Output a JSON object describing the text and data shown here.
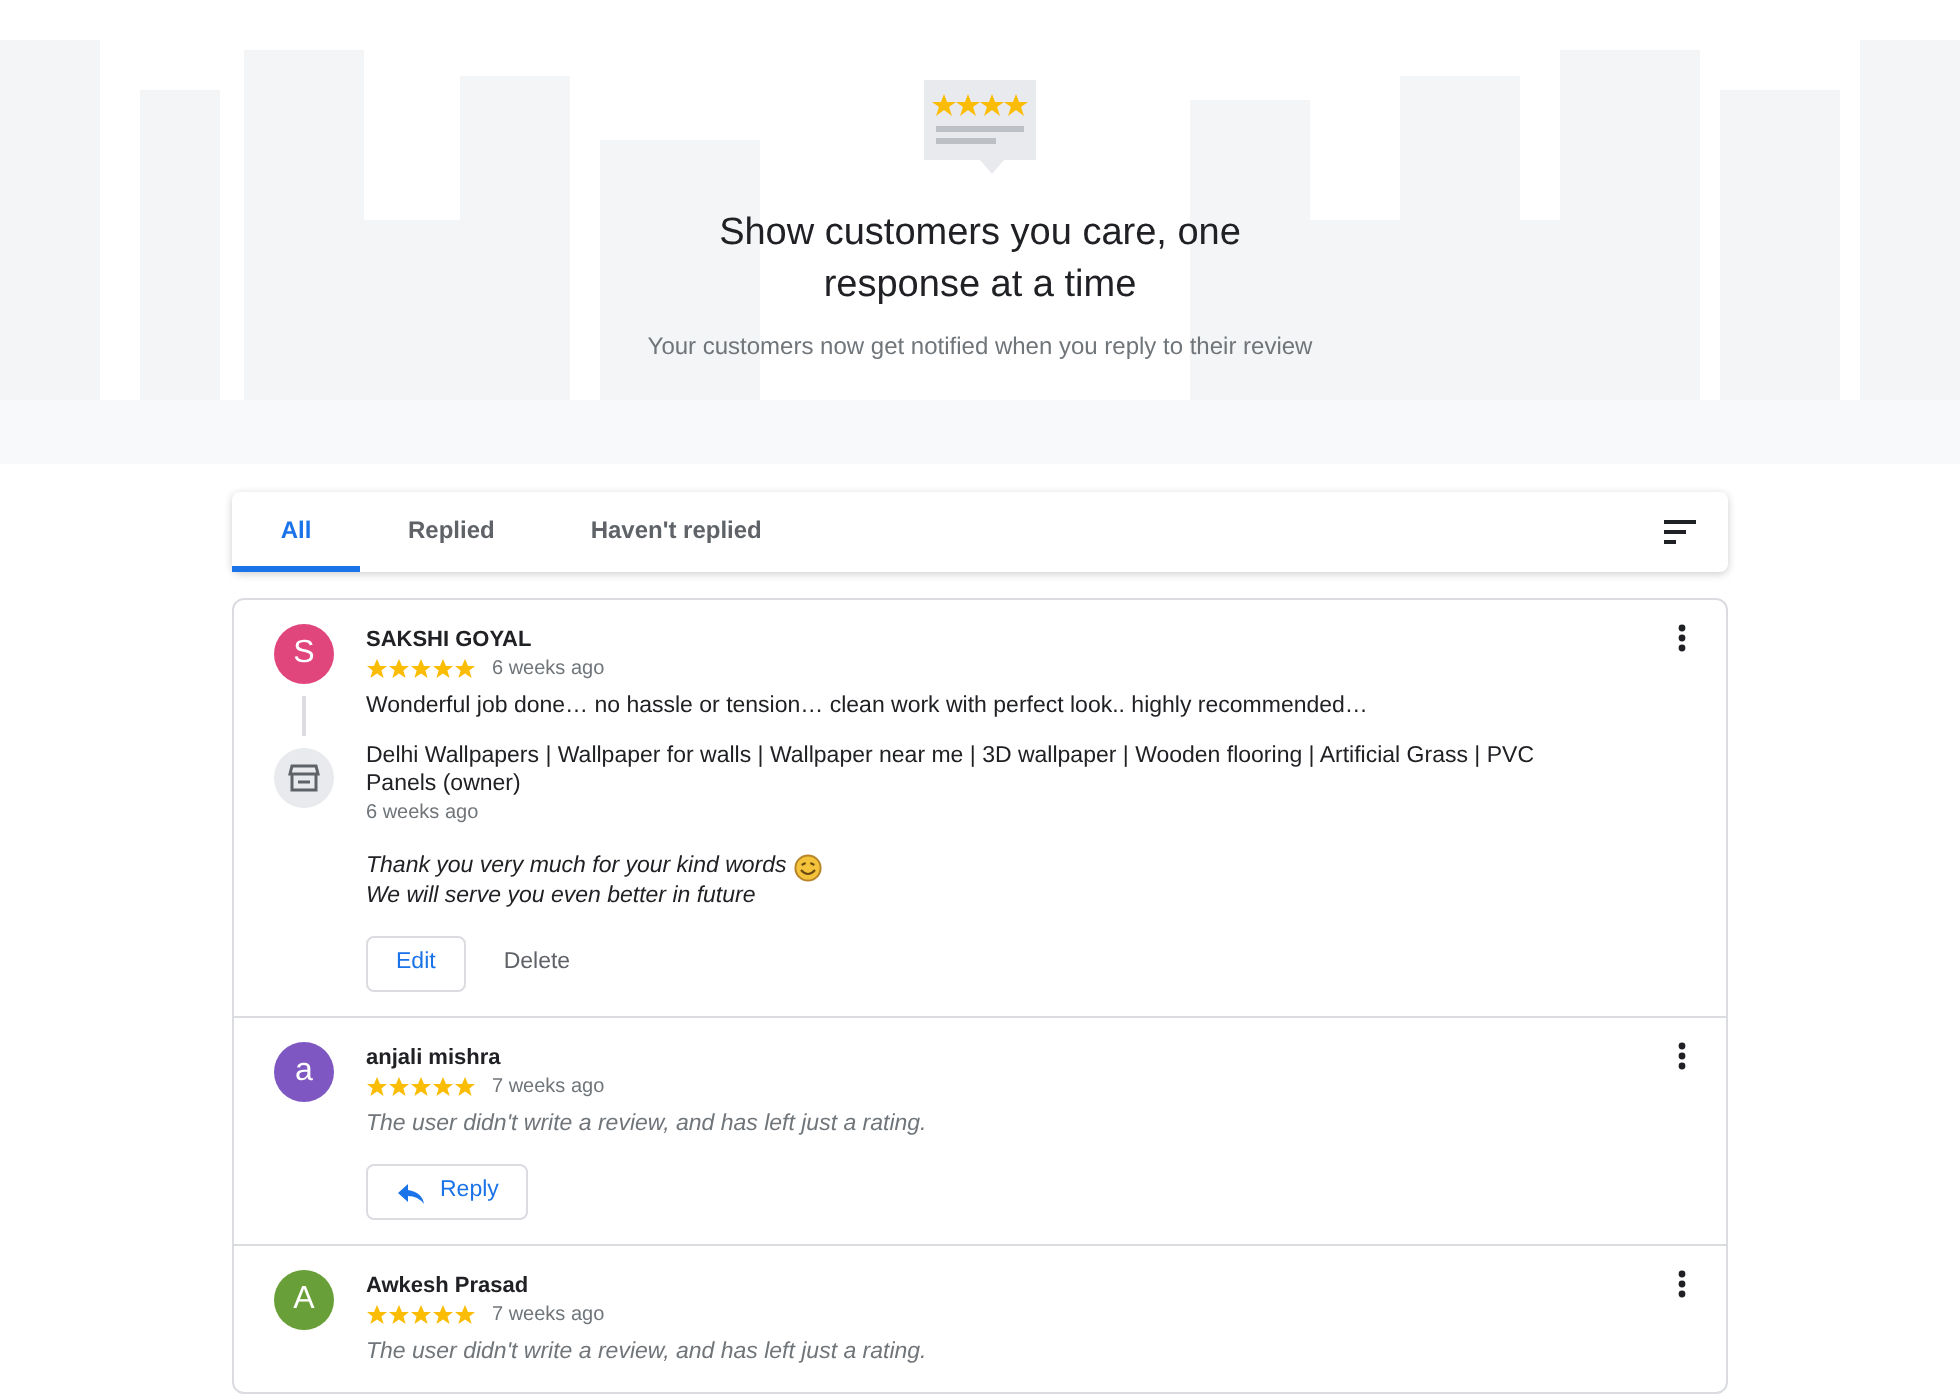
{
  "header": {
    "title": "Show customers you care, one response at a time",
    "subtitle": "Your customers now get notified when you reply to their review"
  },
  "tabs": [
    {
      "label": "All",
      "selected": true
    },
    {
      "label": "Replied",
      "selected": false
    },
    {
      "label": "Haven't replied",
      "selected": false
    }
  ],
  "reviews": [
    {
      "kind": "text",
      "initial": "S",
      "color": "#e0457b",
      "name": "SAKSHI GOYAL",
      "stars": 5,
      "time": "6 weeks ago",
      "text": "Wonderful job done… no hassle or tension… clean work with perfect look.. highly recommended…",
      "owner_reply": {
        "owner": "Delhi Wallpapers | Wallpaper for walls | Wallpaper near me | 3D wallpaper | Wooden flooring | Artificial Grass | PVC Panels (owner)",
        "time": "6 weeks ago",
        "lines": [
          "Thank you very much for your kind words",
          "We will serve you even better in future"
        ]
      },
      "buttons": [
        "Edit",
        "Delete"
      ]
    },
    {
      "kind": "rating_only",
      "initial": "a",
      "color": "#7e57c2",
      "name": "anjali mishra",
      "stars": 5,
      "time": "7 weeks ago",
      "text": "The user didn't write a review, and has left just a rating.",
      "buttons": [
        "Reply"
      ]
    },
    {
      "kind": "rating_only",
      "initial": "A",
      "color": "#689f38",
      "name": "Awkesh Prasad",
      "stars": 5,
      "time": "7 weeks ago",
      "text": "The user didn't write a review, and has left just a rating."
    }
  ]
}
